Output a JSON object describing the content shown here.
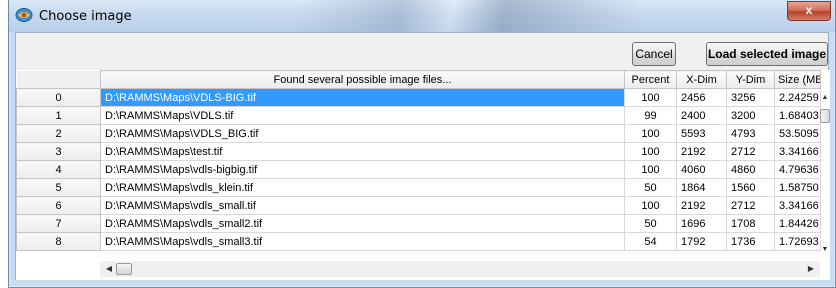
{
  "window": {
    "title": "Choose image",
    "title_icon": "satellite-image-icon",
    "close_label": "x"
  },
  "toolbar": {
    "cancel_label": "Cancel",
    "load_label": "Load selected image"
  },
  "table": {
    "columns": [
      "Found several possible image files...",
      "Percent",
      "X-Dim",
      "Y-Dim",
      "Size (MB)"
    ],
    "selected_row": 0,
    "rows": [
      {
        "index": "0",
        "path": "D:\\RAMMS\\Maps\\VDLS-BIG.tif",
        "percent": "100",
        "xdim": "2456",
        "ydim": "3256",
        "size": "2.24259"
      },
      {
        "index": "1",
        "path": "D:\\RAMMS\\Maps\\VDLS.tif",
        "percent": "99",
        "xdim": "2400",
        "ydim": "3200",
        "size": "1.68403"
      },
      {
        "index": "2",
        "path": "D:\\RAMMS\\Maps\\VDLS_BIG.tif",
        "percent": "100",
        "xdim": "5593",
        "ydim": "4793",
        "size": "53.5095"
      },
      {
        "index": "3",
        "path": "D:\\RAMMS\\Maps\\test.tif",
        "percent": "100",
        "xdim": "2192",
        "ydim": "2712",
        "size": "3.34166"
      },
      {
        "index": "4",
        "path": "D:\\RAMMS\\Maps\\vdls-bigbig.tif",
        "percent": "100",
        "xdim": "4060",
        "ydim": "4860",
        "size": "4.79636"
      },
      {
        "index": "5",
        "path": "D:\\RAMMS\\Maps\\vdls_klein.tif",
        "percent": "50",
        "xdim": "1864",
        "ydim": "1560",
        "size": "1.58750"
      },
      {
        "index": "6",
        "path": "D:\\RAMMS\\Maps\\vdls_small.tif",
        "percent": "100",
        "xdim": "2192",
        "ydim": "2712",
        "size": "3.34166"
      },
      {
        "index": "7",
        "path": "D:\\RAMMS\\Maps\\vdls_small2.tif",
        "percent": "50",
        "xdim": "1696",
        "ydim": "1708",
        "size": "1.84426"
      },
      {
        "index": "8",
        "path": "D:\\RAMMS\\Maps\\vdls_small3.tif",
        "percent": "54",
        "xdim": "1792",
        "ydim": "1736",
        "size": "1.72693"
      }
    ]
  }
}
